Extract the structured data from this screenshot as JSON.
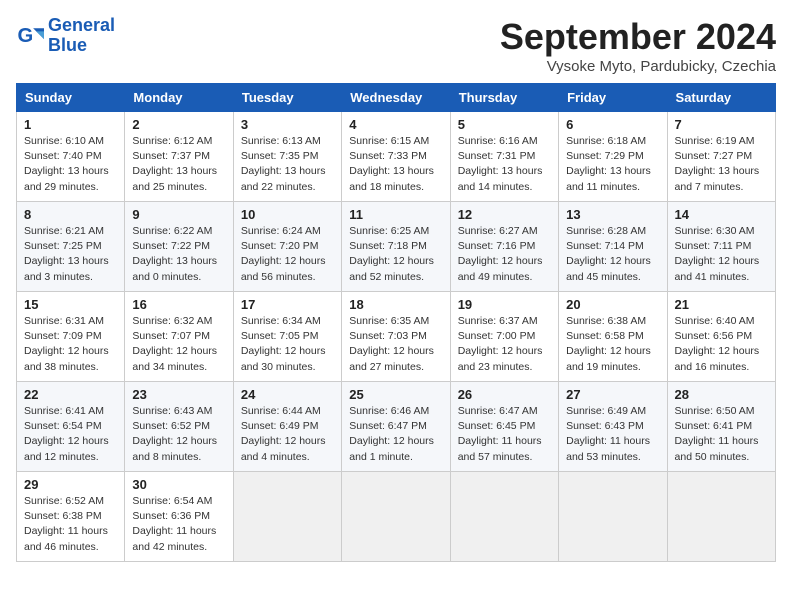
{
  "header": {
    "logo_line1": "General",
    "logo_line2": "Blue",
    "month_title": "September 2024",
    "location": "Vysoke Myto, Pardubicky, Czechia"
  },
  "weekdays": [
    "Sunday",
    "Monday",
    "Tuesday",
    "Wednesday",
    "Thursday",
    "Friday",
    "Saturday"
  ],
  "weeks": [
    [
      {
        "day": "1",
        "detail": "Sunrise: 6:10 AM\nSunset: 7:40 PM\nDaylight: 13 hours\nand 29 minutes."
      },
      {
        "day": "2",
        "detail": "Sunrise: 6:12 AM\nSunset: 7:37 PM\nDaylight: 13 hours\nand 25 minutes."
      },
      {
        "day": "3",
        "detail": "Sunrise: 6:13 AM\nSunset: 7:35 PM\nDaylight: 13 hours\nand 22 minutes."
      },
      {
        "day": "4",
        "detail": "Sunrise: 6:15 AM\nSunset: 7:33 PM\nDaylight: 13 hours\nand 18 minutes."
      },
      {
        "day": "5",
        "detail": "Sunrise: 6:16 AM\nSunset: 7:31 PM\nDaylight: 13 hours\nand 14 minutes."
      },
      {
        "day": "6",
        "detail": "Sunrise: 6:18 AM\nSunset: 7:29 PM\nDaylight: 13 hours\nand 11 minutes."
      },
      {
        "day": "7",
        "detail": "Sunrise: 6:19 AM\nSunset: 7:27 PM\nDaylight: 13 hours\nand 7 minutes."
      }
    ],
    [
      {
        "day": "8",
        "detail": "Sunrise: 6:21 AM\nSunset: 7:25 PM\nDaylight: 13 hours\nand 3 minutes."
      },
      {
        "day": "9",
        "detail": "Sunrise: 6:22 AM\nSunset: 7:22 PM\nDaylight: 13 hours\nand 0 minutes."
      },
      {
        "day": "10",
        "detail": "Sunrise: 6:24 AM\nSunset: 7:20 PM\nDaylight: 12 hours\nand 56 minutes."
      },
      {
        "day": "11",
        "detail": "Sunrise: 6:25 AM\nSunset: 7:18 PM\nDaylight: 12 hours\nand 52 minutes."
      },
      {
        "day": "12",
        "detail": "Sunrise: 6:27 AM\nSunset: 7:16 PM\nDaylight: 12 hours\nand 49 minutes."
      },
      {
        "day": "13",
        "detail": "Sunrise: 6:28 AM\nSunset: 7:14 PM\nDaylight: 12 hours\nand 45 minutes."
      },
      {
        "day": "14",
        "detail": "Sunrise: 6:30 AM\nSunset: 7:11 PM\nDaylight: 12 hours\nand 41 minutes."
      }
    ],
    [
      {
        "day": "15",
        "detail": "Sunrise: 6:31 AM\nSunset: 7:09 PM\nDaylight: 12 hours\nand 38 minutes."
      },
      {
        "day": "16",
        "detail": "Sunrise: 6:32 AM\nSunset: 7:07 PM\nDaylight: 12 hours\nand 34 minutes."
      },
      {
        "day": "17",
        "detail": "Sunrise: 6:34 AM\nSunset: 7:05 PM\nDaylight: 12 hours\nand 30 minutes."
      },
      {
        "day": "18",
        "detail": "Sunrise: 6:35 AM\nSunset: 7:03 PM\nDaylight: 12 hours\nand 27 minutes."
      },
      {
        "day": "19",
        "detail": "Sunrise: 6:37 AM\nSunset: 7:00 PM\nDaylight: 12 hours\nand 23 minutes."
      },
      {
        "day": "20",
        "detail": "Sunrise: 6:38 AM\nSunset: 6:58 PM\nDaylight: 12 hours\nand 19 minutes."
      },
      {
        "day": "21",
        "detail": "Sunrise: 6:40 AM\nSunset: 6:56 PM\nDaylight: 12 hours\nand 16 minutes."
      }
    ],
    [
      {
        "day": "22",
        "detail": "Sunrise: 6:41 AM\nSunset: 6:54 PM\nDaylight: 12 hours\nand 12 minutes."
      },
      {
        "day": "23",
        "detail": "Sunrise: 6:43 AM\nSunset: 6:52 PM\nDaylight: 12 hours\nand 8 minutes."
      },
      {
        "day": "24",
        "detail": "Sunrise: 6:44 AM\nSunset: 6:49 PM\nDaylight: 12 hours\nand 4 minutes."
      },
      {
        "day": "25",
        "detail": "Sunrise: 6:46 AM\nSunset: 6:47 PM\nDaylight: 12 hours\nand 1 minute."
      },
      {
        "day": "26",
        "detail": "Sunrise: 6:47 AM\nSunset: 6:45 PM\nDaylight: 11 hours\nand 57 minutes."
      },
      {
        "day": "27",
        "detail": "Sunrise: 6:49 AM\nSunset: 6:43 PM\nDaylight: 11 hours\nand 53 minutes."
      },
      {
        "day": "28",
        "detail": "Sunrise: 6:50 AM\nSunset: 6:41 PM\nDaylight: 11 hours\nand 50 minutes."
      }
    ],
    [
      {
        "day": "29",
        "detail": "Sunrise: 6:52 AM\nSunset: 6:38 PM\nDaylight: 11 hours\nand 46 minutes."
      },
      {
        "day": "30",
        "detail": "Sunrise: 6:54 AM\nSunset: 6:36 PM\nDaylight: 11 hours\nand 42 minutes."
      },
      null,
      null,
      null,
      null,
      null
    ]
  ]
}
